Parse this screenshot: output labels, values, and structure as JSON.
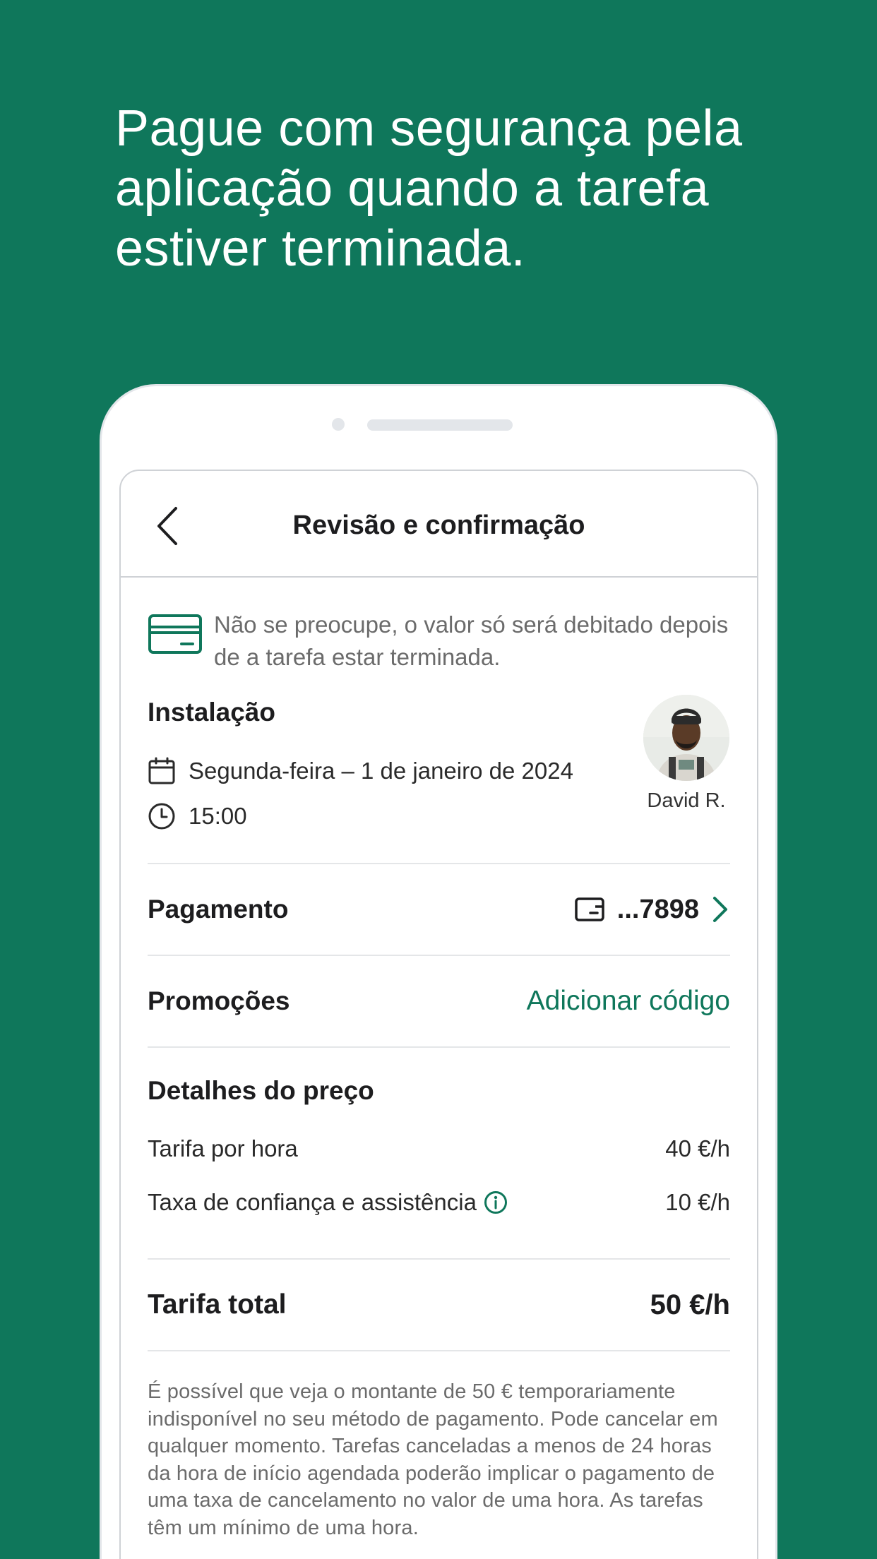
{
  "headline": "Pague com segurança pela aplicação quando a tarefa estiver terminada.",
  "colors": {
    "brand_green": "#0f775b",
    "text_dark": "#1d1d1f",
    "text_muted": "#6b6b6b"
  },
  "nav": {
    "title": "Revisão e confirmação",
    "back_icon": "chevron-left-icon"
  },
  "notice": {
    "icon": "credit-card-icon",
    "text": "Não se preocupe, o valor só será debitado depois de a tarefa estar terminada."
  },
  "task": {
    "title": "Instalação",
    "date": "Segunda-feira – 1 de janeiro de 2024",
    "time": "15:00",
    "tasker_name": "David R."
  },
  "payment": {
    "label": "Pagamento",
    "card_digits": "...7898"
  },
  "promotions": {
    "label": "Promoções",
    "link": "Adicionar código"
  },
  "price_details": {
    "title": "Detalhes do preço",
    "rows": [
      {
        "label": "Tarifa por hora",
        "value": "40 €/h"
      },
      {
        "label": "Taxa de confiança e assistência",
        "value": "10 €/h"
      }
    ]
  },
  "total": {
    "label": "Tarifa total",
    "value": "50 €/h"
  },
  "disclaimer": "É possível que veja o montante de 50 € temporariamente indisponível no seu método de pagamento. Pode cancelar em qualquer momento. Tarefas canceladas a menos de 24 horas da hora de início agendada poderão implicar o pagamento de uma taxa de cancelamento no valor de uma hora. As tarefas têm um mínimo de uma hora."
}
